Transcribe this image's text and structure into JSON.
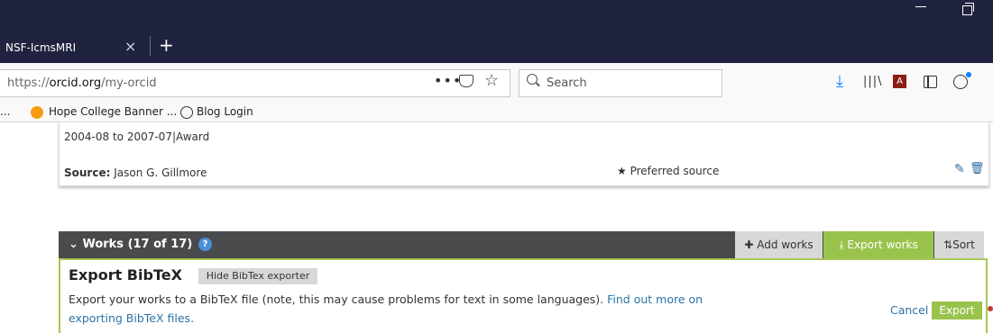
{
  "browser": {
    "tab_title": "NSF-IcmsMRI",
    "tab_close": "×",
    "new_tab": "+",
    "url_prefix": "https://",
    "url_host": "orcid.org",
    "url_path": "/my-orcid",
    "page_actions": "•••",
    "bookmark_star": "☆",
    "search_placeholder": "Search"
  },
  "bookmarks": {
    "partial": "...",
    "hope": "Hope College Banner ...",
    "blog": "Blog Login"
  },
  "award_card": {
    "date_range": "2004-08 to 2007-07|Award",
    "source_label": "Source:",
    "source_name": "Jason G. Gillmore",
    "preferred_star": "★",
    "preferred": "Preferred source"
  },
  "works": {
    "title": "Works (17 of 17)",
    "help": "?",
    "add_works": "Add works",
    "export_works": "Export works",
    "sort": "Sort"
  },
  "bibtex": {
    "title": "Export BibTeX",
    "hide_button": "Hide BibTex exporter",
    "description": "Export your works to a BibTeX file (note, this may cause problems for text in some languages).",
    "link_text": "Find out more on exporting BibTeX files.",
    "cancel": "Cancel",
    "export": "Export"
  },
  "colors": {
    "titlebar": "#202340",
    "orcid_green": "#9ac34c",
    "works_bar": "#494a4c",
    "link": "#2a73a8"
  }
}
